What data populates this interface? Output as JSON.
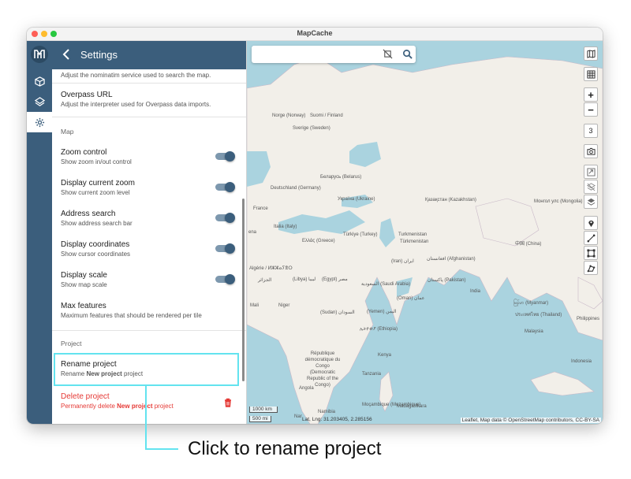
{
  "window": {
    "title": "MapCache"
  },
  "panel": {
    "title": "Settings",
    "items": {
      "nominatim_sub": "Adjust the nominatim service used to search the map.",
      "overpass_title": "Overpass URL",
      "overpass_sub": "Adjust the interpreter used for Overpass data imports.",
      "section_map": "Map",
      "zoom_title": "Zoom control",
      "zoom_sub": "Show zoom in/out control",
      "curzoom_title": "Display current zoom",
      "curzoom_sub": "Show current zoom level",
      "addr_title": "Address search",
      "addr_sub": "Show address search bar",
      "coords_title": "Display coordinates",
      "coords_sub": "Show cursor coordinates",
      "scale_title": "Display scale",
      "scale_sub": "Show map scale",
      "maxf_title": "Max features",
      "maxf_sub": "Maximum features that should be rendered per tile",
      "section_project": "Project",
      "rename_title": "Rename project",
      "rename_sub_pre": "Rename ",
      "rename_sub_bold": "New project",
      "rename_sub_post": " project",
      "delete_title": "Delete project",
      "delete_sub_pre": "Permanently delete ",
      "delete_sub_bold": "New project",
      "delete_sub_post": " project"
    },
    "toggles": {
      "zoom": true,
      "curzoom": true,
      "addr": true,
      "coords": true,
      "scale": true
    }
  },
  "map": {
    "zoom_level": "3",
    "scale_km": "1000 km",
    "scale_mi": "500 mi",
    "coords": "Lat, Lng: 31.203405, 2.285156",
    "attribution": "Leaflet, Map data © OpenStreetMap contributors, CC-BY-SA",
    "labels": [
      "Norge (Norway)",
      "Sverige (Sweden)",
      "Suomi / Finland",
      "Беларусь (Belarus)",
      "Deutschland (Germany)",
      "Україна (Ukraine)",
      "France",
      "Italia (Italy)",
      "Ελλάς (Greece)",
      "Türkiye (Turkey)",
      "Қазақстан (Kazakhstan)",
      "Монгол улс (Mongolia)",
      "Turkmenistan",
      "Türkmenistan",
      "(Iran) ایران",
      "افغانستان (Afghanistan)",
      "پاکستان (Pakistan)",
      "中国 (China)",
      "India",
      "Algérie / ⵍⵣⵣⴰⵢⴻⵔ",
      "الجزائر",
      "(Libya) ليبيا",
      "(Egypt) مصر",
      "السعودية (Saudi Arabia)",
      "(Oman) عمان",
      "(Yemen) اليمن",
      "ኢትዮጵያ (Ethiopia)",
      "(Sudan) السودان",
      "Mali",
      "Niger",
      "Kenya",
      "Tanzania",
      "République démocratique du Congo (Democratic Republic of the Congo)",
      "Angola",
      "Namibia",
      "Moçambique (Mozambique)",
      "Madagasikara",
      "မြန်မာ (Myanmar)",
      "ประเทศไทย (Thailand)",
      "Philippines",
      "Malaysia",
      "Indonesia",
      "Nar",
      "ena"
    ]
  },
  "annotation": {
    "callout": "Click to rename project"
  }
}
